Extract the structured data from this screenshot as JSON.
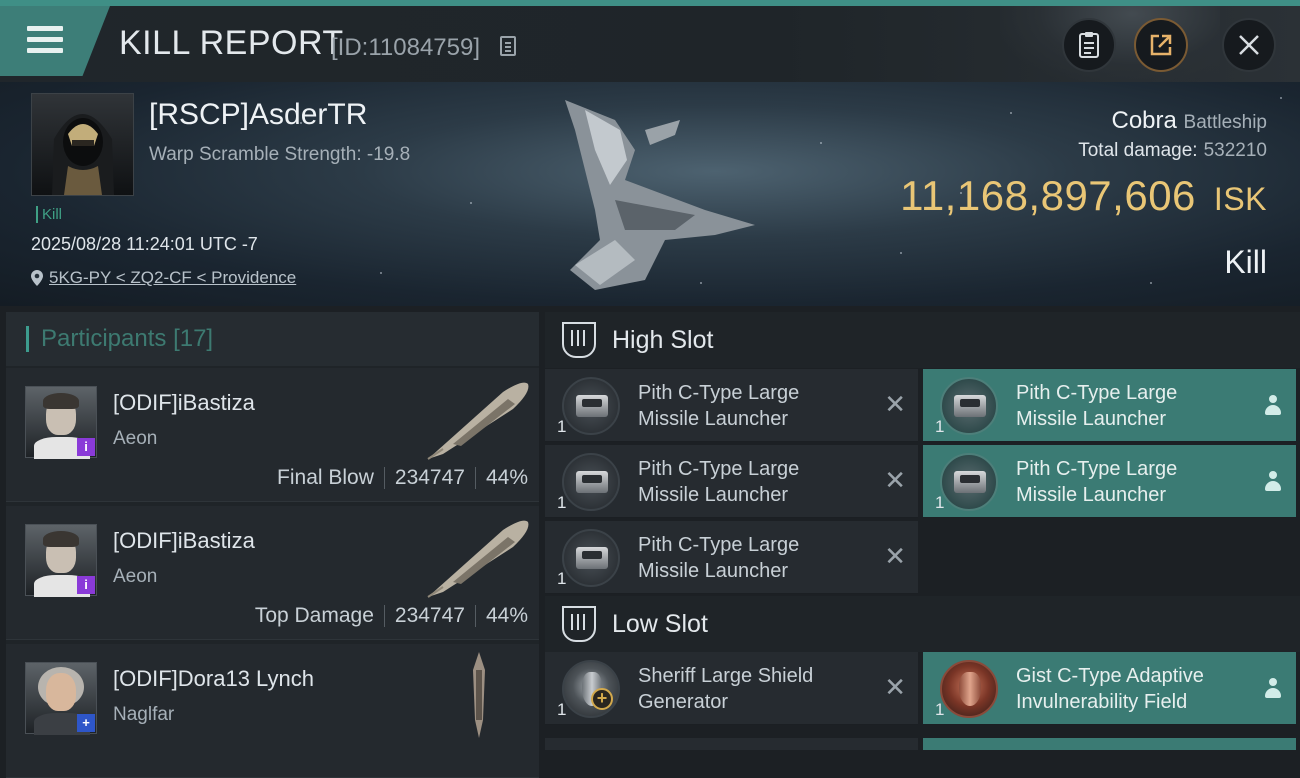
{
  "header": {
    "title": "KILL REPORT",
    "report_id": "[ID:11084759]",
    "buttons": [
      "clipboard-icon",
      "share-icon",
      "close-icon"
    ]
  },
  "victim": {
    "name": "[RSCP]AsderTR",
    "warp_scramble": "Warp Scramble Strength: -19.8",
    "tag": "Kill",
    "datetime": "2025/08/28 11:24:01 UTC -7",
    "location": "5KG-PY < ZQ2-CF < Providence",
    "ship": "Cobra",
    "ship_class": "Battleship",
    "total_damage_label": "Total damage:",
    "total_damage": "532210",
    "isk_value": "11,168,897,606",
    "isk_unit": "ISK",
    "result": "Kill"
  },
  "participants": {
    "label": "Participants",
    "count": "[17]",
    "items": [
      {
        "name": "[ODIF]iBastiza",
        "ship": "Aeon",
        "role": "Final Blow",
        "damage": "234747",
        "percent": "44%",
        "badge": "i",
        "badge_color": "#8a3ad8"
      },
      {
        "name": "[ODIF]iBastiza",
        "ship": "Aeon",
        "role": "Top Damage",
        "damage": "234747",
        "percent": "44%",
        "badge": "i",
        "badge_color": "#8a3ad8"
      },
      {
        "name": "[ODIF]Dora13 Lynch",
        "ship": "Naglfar",
        "badge": "+",
        "badge_color": "#2e56c9"
      }
    ]
  },
  "slots": {
    "high": {
      "label": "High Slot",
      "modules": [
        {
          "name": "Pith C-Type Large Missile Launcher",
          "qty": "1",
          "status": "destroyed"
        },
        {
          "name": "Pith C-Type Large Missile Launcher",
          "qty": "1",
          "status": "dropped"
        },
        {
          "name": "Pith C-Type Large Missile Launcher",
          "qty": "1",
          "status": "destroyed"
        },
        {
          "name": "Pith C-Type Large Missile Launcher",
          "qty": "1",
          "status": "dropped"
        },
        {
          "name": "Pith C-Type Large Missile Launcher",
          "qty": "1",
          "status": "destroyed"
        }
      ]
    },
    "low": {
      "label": "Low Slot",
      "modules": [
        {
          "name": "Sheriff Large Shield Generator",
          "qty": "1",
          "status": "destroyed"
        },
        {
          "name": "Gist C-Type Adaptive Invulnerability Field",
          "qty": "1",
          "status": "dropped"
        }
      ]
    }
  },
  "colors": {
    "accent_teal": "#3d7e78",
    "isk_gold": "#e9c676",
    "dropped_bg": "#3b7b74"
  }
}
